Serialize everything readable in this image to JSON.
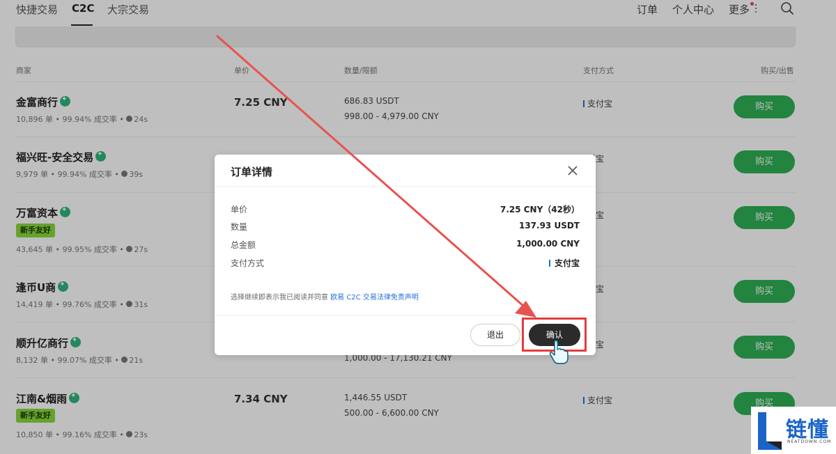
{
  "nav": {
    "tabs": [
      "快捷交易",
      "C2C",
      "大宗交易"
    ],
    "right": [
      "订单",
      "个人中心",
      "更多"
    ]
  },
  "table": {
    "headers": [
      "商家",
      "单价",
      "数量/限额",
      "支付方式",
      "购买/出售"
    ],
    "rows": [
      {
        "merchant": "金富商行",
        "stats": "10,896 单 • 99.94% 成交率 •",
        "time": "24s",
        "badge": "",
        "price": "7.25 CNY",
        "qty": "686.83 USDT",
        "limit": "998.00 - 4,979.00 CNY",
        "pay": "支付宝",
        "action": "购买"
      },
      {
        "merchant": "福兴旺-安全交易",
        "stats": "9,979 单 • 99.94% 成交率 •",
        "time": "39s",
        "badge": "",
        "price": "",
        "qty": "",
        "limit": "",
        "pay": "付宝",
        "action": "购买"
      },
      {
        "merchant": "万富资本",
        "stats": "43,645 单 • 99.95% 成交率 •",
        "time": "27s",
        "badge": "新手友好",
        "price": "",
        "qty": "",
        "limit": "",
        "pay": "付宝",
        "action": "购买"
      },
      {
        "merchant": "逢币U商",
        "stats": "14,419 单 • 99.76% 成交率 •",
        "time": "31s",
        "badge": "",
        "price": "",
        "qty": "",
        "limit": "",
        "pay": "付宝",
        "action": "购买"
      },
      {
        "merchant": "顺升亿商行",
        "stats": "8,132 单 • 99.07% 成交率 •",
        "time": "21s",
        "badge": "",
        "price": "",
        "qty": "",
        "limit": "1,000.00 - 17,130.21 CNY",
        "pay": "付宝",
        "action": "购买"
      },
      {
        "merchant": "江南&烟雨",
        "stats": "10,850 单 • 99.16% 成交率 •",
        "time": "23s",
        "badge": "新手友好",
        "price": "7.34 CNY",
        "qty": "1,446.55 USDT",
        "limit": "500.00 - 6,600.00 CNY",
        "pay": "支付宝",
        "action": "购买"
      }
    ]
  },
  "modal": {
    "title": "订单详情",
    "fields": [
      {
        "label": "单价",
        "value": "7.25 CNY（42秒）"
      },
      {
        "label": "数量",
        "value": "137.93 USDT"
      },
      {
        "label": "总金额",
        "value": "1,000.00 CNY"
      },
      {
        "label": "支付方式",
        "value": "支付宝"
      }
    ],
    "agree_prefix": "选择继续即表示我已阅读并同意",
    "agree_link": "欧易 C2C 交易法律免责声明",
    "exit_label": "退出",
    "confirm_label": "确认"
  },
  "watermark": {
    "text": "链懂",
    "sub": "NEATDOWN.COM"
  },
  "colors": {
    "buy_green": "#2eb154",
    "annotation_red": "#e43c3c",
    "link_blue": "#1f6fd6",
    "confirm_dark": "#2b2b2b"
  },
  "icons": [
    "verified-icon",
    "clock-icon",
    "close-icon",
    "search-icon",
    "more-icon",
    "pointer-hand-icon",
    "annotation-arrow"
  ]
}
